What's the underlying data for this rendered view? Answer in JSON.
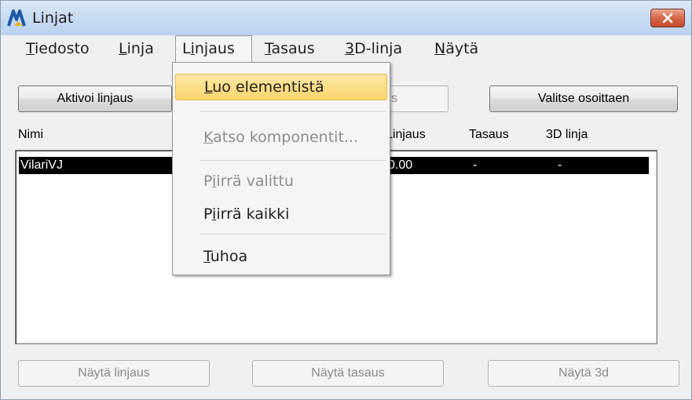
{
  "window": {
    "title": "Linjat"
  },
  "menubar": [
    {
      "label": "Tiedosto",
      "key": "T",
      "rest": "iedosto"
    },
    {
      "label": "Linja",
      "key": "L",
      "rest": "inja"
    },
    {
      "label": "Linjaus",
      "key": "i",
      "pre": "L",
      "rest": "njaus"
    },
    {
      "label": "Tasaus",
      "key": "T",
      "rest": "asaus"
    },
    {
      "label": "3D-linja",
      "key": "3",
      "rest": "D-linja"
    },
    {
      "label": "Näytä",
      "key": "N",
      "rest": "äytä"
    }
  ],
  "dropdown": [
    {
      "label": "Luo elementistä",
      "key": "L",
      "rest": "uo elementistä",
      "state": "highlighted"
    },
    {
      "label": "Katso komponentit...",
      "key": "K",
      "rest": "atso komponentit...",
      "state": "disabled"
    },
    {
      "label": "Piirrä valittu",
      "pre": "P",
      "key": "i",
      "rest": "irrä valittu",
      "state": "disabled"
    },
    {
      "label": "Piirrä kaikki",
      "pre": "P",
      "key": "i",
      "rest": "irrä kaikki",
      "state": "enabled"
    },
    {
      "label": "Tuhoa",
      "key": "T",
      "rest": "uhoa",
      "state": "enabled"
    }
  ],
  "toolbar": {
    "activate": "Aktivoi linjaus",
    "hidden_partial": "s",
    "select_by_pointing": "Valitse osoittaen"
  },
  "columns": [
    "Nimi",
    "Linjaus",
    "Tasaus",
    "3D linja"
  ],
  "rows": [
    {
      "name": "VilariVJ",
      "linjaus": "0.00",
      "tasaus": "-",
      "linja3d": "-"
    }
  ],
  "bottom_buttons": {
    "show_alignment": "Näytä linjaus",
    "show_profile": "Näytä tasaus",
    "show_3d": "Näytä 3d"
  }
}
